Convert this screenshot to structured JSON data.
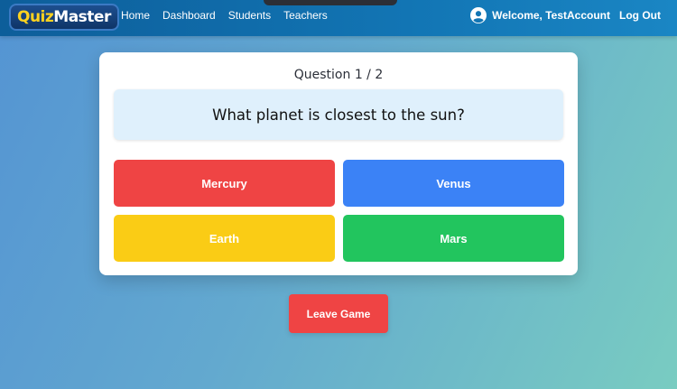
{
  "app": {
    "logo_part1": "Quiz",
    "logo_part2": "Master"
  },
  "nav": {
    "links": [
      "Home",
      "Dashboard",
      "Students",
      "Teachers"
    ]
  },
  "user": {
    "welcome": "Welcome, TestAccount",
    "logout": "Log Out"
  },
  "quiz": {
    "counter": "Question 1 / 2",
    "question": "What planet is closest to the sun?",
    "answers": [
      {
        "label": "Mercury",
        "color": "#ef4444"
      },
      {
        "label": "Venus",
        "color": "#3b82f6"
      },
      {
        "label": "Earth",
        "color": "#facc15"
      },
      {
        "label": "Mars",
        "color": "#22c55e"
      }
    ]
  },
  "actions": {
    "leave_label": "Leave Game",
    "leave_color": "#ef4444"
  },
  "icons": {
    "user": "user-circle-icon"
  }
}
